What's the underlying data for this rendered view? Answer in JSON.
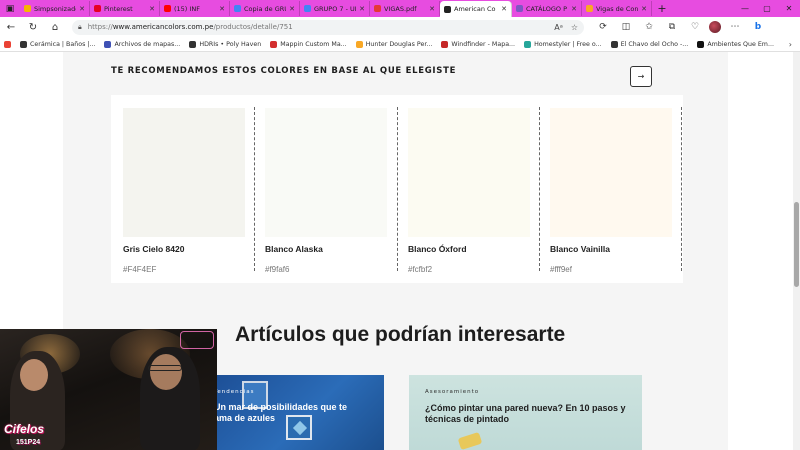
{
  "browser": {
    "tabs": [
      {
        "label": "Simpsonizador",
        "color": "#f7b500",
        "active": false
      },
      {
        "label": "Pinterest",
        "color": "#e60023",
        "active": false
      },
      {
        "label": "(15) INF",
        "color": "#ff0000",
        "active": false
      },
      {
        "label": "Copia de GRU",
        "color": "#4285f4",
        "active": false
      },
      {
        "label": "GRUPO 7 - UL",
        "color": "#4285f4",
        "active": false
      },
      {
        "label": "VIGAS.pdf",
        "color": "#e53935",
        "active": false
      },
      {
        "label": "American Co",
        "color": "#222222",
        "active": true
      },
      {
        "label": "CATÁLOGO P",
        "color": "#7e57c2",
        "active": false
      },
      {
        "label": "Vigas de Con",
        "color": "#f9a825",
        "active": false
      }
    ],
    "url_prefix": "https://",
    "url_host": "www.americancolors.com.pe",
    "url_path": "/productos/detalle/751",
    "bookmarks": [
      {
        "label": "Cerámica | Baños |...",
        "color": "#333333"
      },
      {
        "label": "Archivos de mapas...",
        "color": "#3f51b5"
      },
      {
        "label": "HDRIs • Poly Haven",
        "color": "#333333"
      },
      {
        "label": "Mappin Custom Ma...",
        "color": "#d32f2f"
      },
      {
        "label": "Hunter Douglas Per...",
        "color": "#f9a825"
      },
      {
        "label": "Windfinder - Mapa...",
        "color": "#c62828"
      },
      {
        "label": "Homestyler | Free o...",
        "color": "#26a69a"
      },
      {
        "label": "El Chavo del Ocho -...",
        "color": "#333333"
      },
      {
        "label": "Ambientes Que Em...",
        "color": "#111111"
      }
    ]
  },
  "recommend": {
    "title": "TE RECOMENDAMOS ESTOS COLORES EN BASE AL QUE ELEGISTE",
    "next_icon": "arrow-right-icon",
    "swatches": [
      {
        "name": "Gris Cielo 8420",
        "code": "#F4F4EF",
        "color": "#F4F4EF"
      },
      {
        "name": "Blanco Alaska",
        "code": "#f9faf6",
        "color": "#f9faf6"
      },
      {
        "name": "Blanco Óxford",
        "code": "#fcfbf2",
        "color": "#fcfbf2"
      },
      {
        "name": "Blanco Vainilla",
        "code": "#fff9ef",
        "color": "#fff9ef"
      }
    ]
  },
  "articles": {
    "title": "Artículos que podrían interesarte",
    "items": [
      {
        "tag": "Tendencias",
        "title": "Un mar de posibilidades que te ama de azules"
      },
      {
        "tag": "Asesoramiento",
        "title": "¿Cómo pintar una pared nueva? En 10 pasos y técnicas de pintado"
      }
    ]
  },
  "video_overlay": {
    "logo": "Cifelos",
    "sub": "151P24"
  }
}
